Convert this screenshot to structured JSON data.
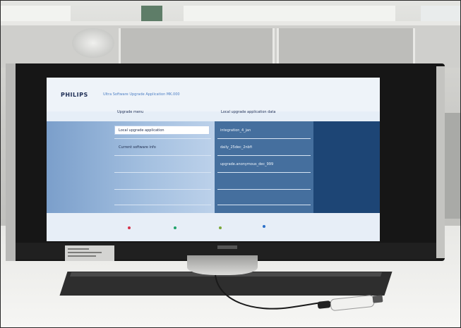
{
  "tv_screen": {
    "brand": "PHILIPS",
    "title": "Ultra Software Upgrade Application MK.000",
    "left_column_header": "Upgrade menu",
    "right_column_header": "Local upgrade application data",
    "left_items": [
      "Local upgrade application",
      "Current software info"
    ],
    "right_items": [
      "integration_4_jan",
      "daily_25dec_2nbfi",
      "upgrade.anonymous_dec_999"
    ],
    "color_key_dots": [
      "#d6334b",
      "#1fa36b",
      "#7ba83a",
      "#2a6fc9"
    ],
    "colors": {
      "left_panel": "#8fb0d6",
      "middle_panel": "#456f9e",
      "right_panel": "#1d4575",
      "header": "#eef3f9"
    }
  }
}
